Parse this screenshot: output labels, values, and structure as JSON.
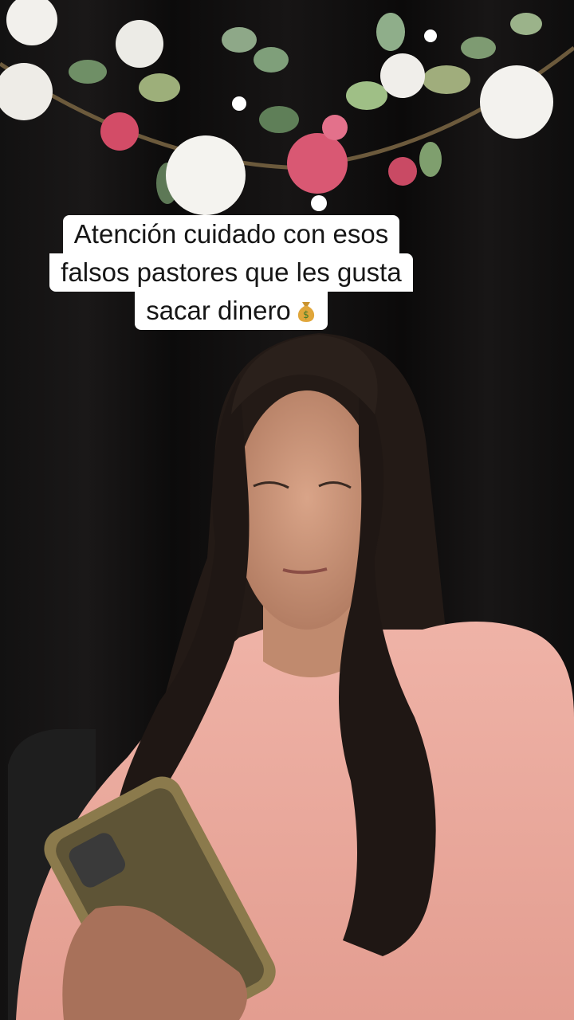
{
  "caption": {
    "line1": "Atención cuidado con esos",
    "line2": "falsos pastores que les gusta",
    "line3": "sacar dinero",
    "emoji_icon": "money-bag-icon"
  },
  "colors": {
    "caption_bg": "#ffffff",
    "caption_text": "#161616",
    "backdrop": "#0d0c0c",
    "sweater": "#e9a79c"
  }
}
